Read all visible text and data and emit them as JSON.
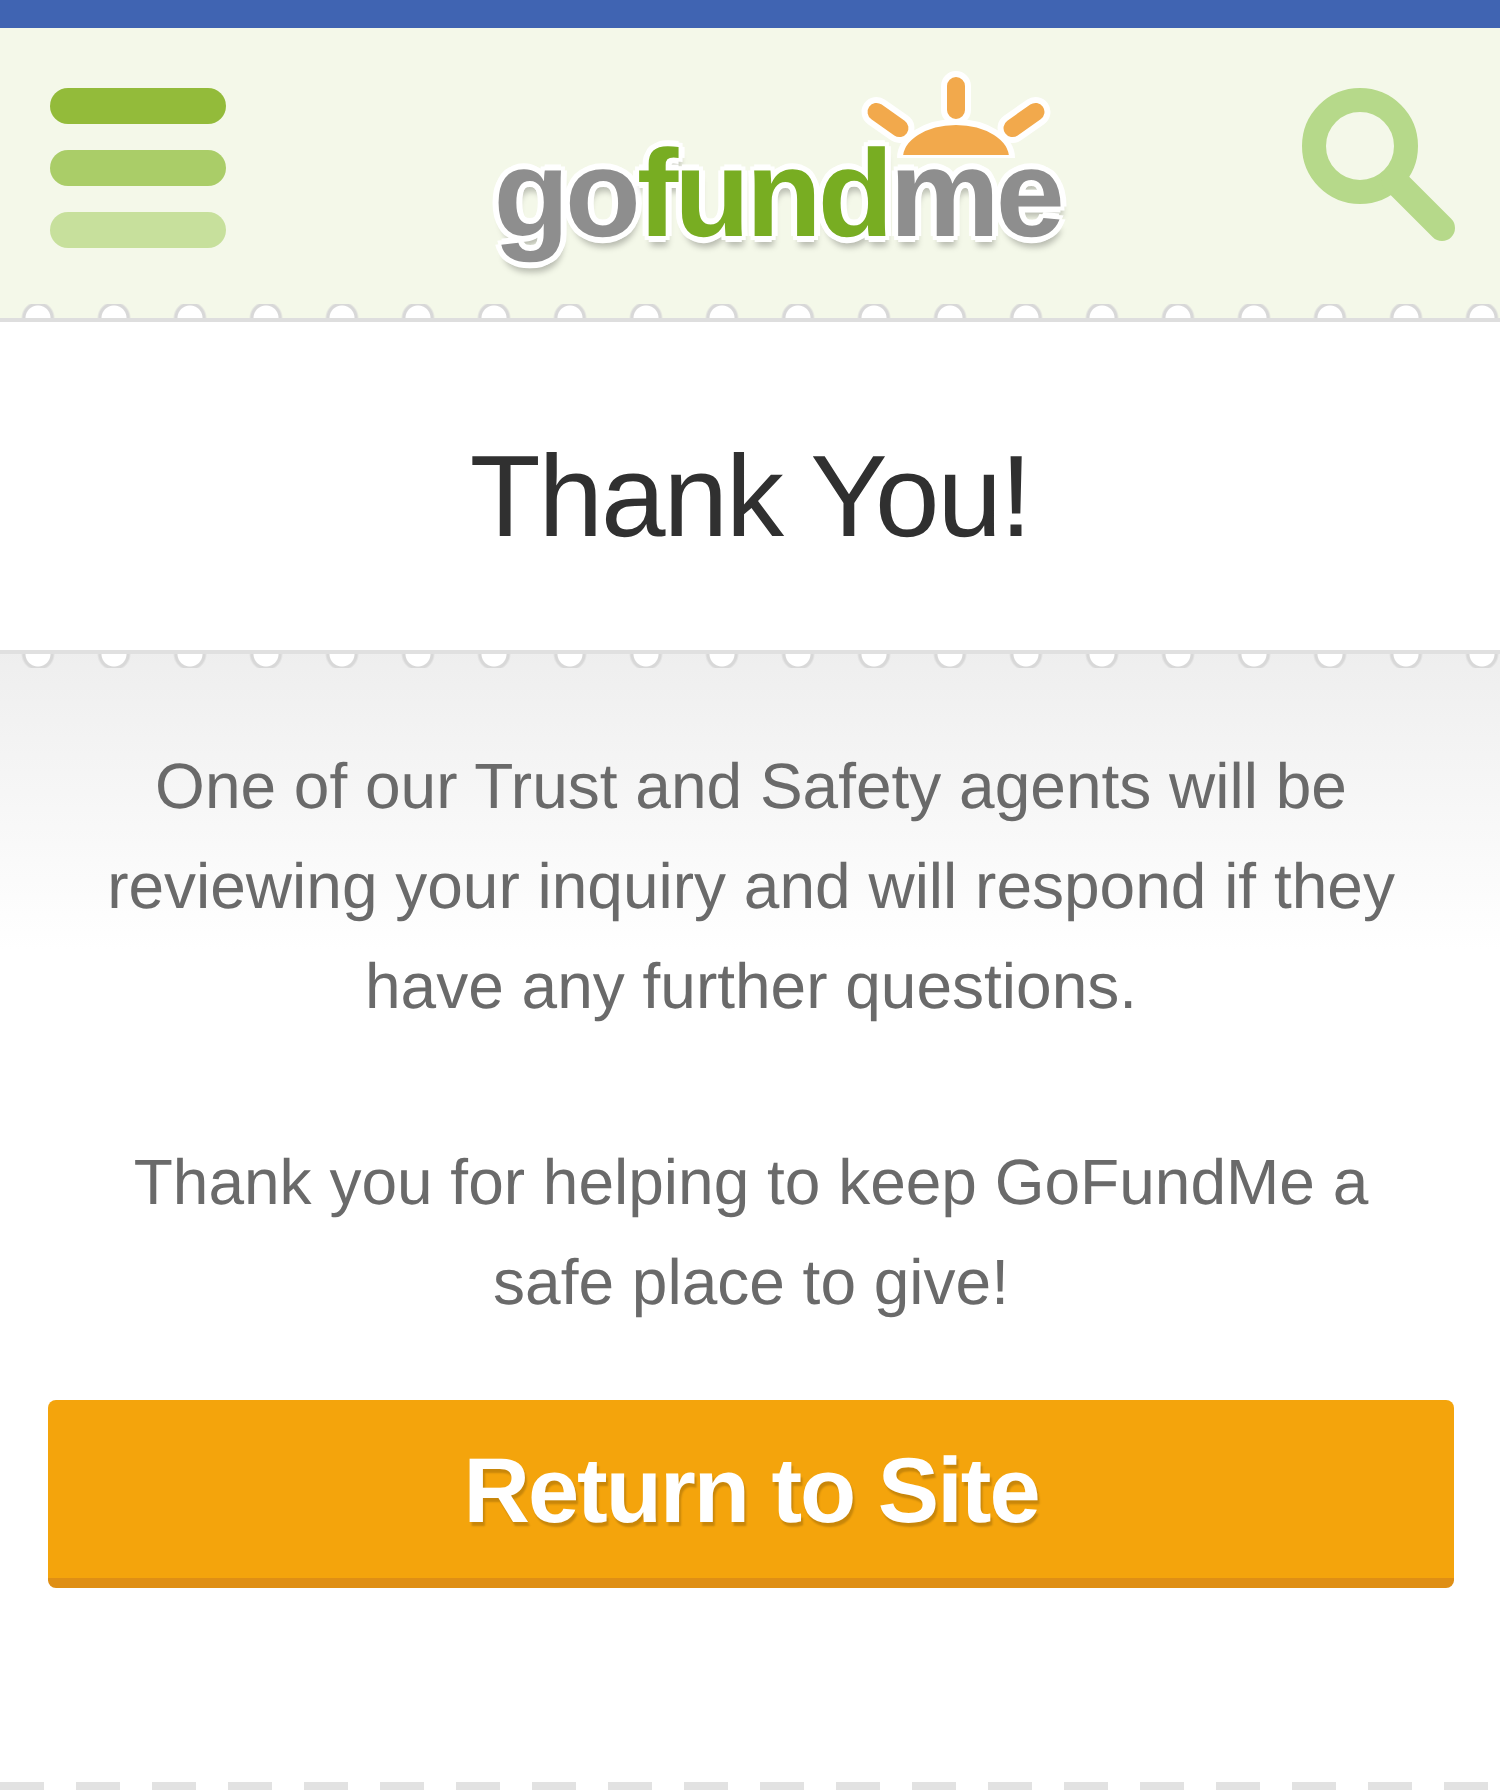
{
  "header": {
    "logo": {
      "parts": [
        {
          "text": "go",
          "color": "#8e8e8e"
        },
        {
          "text": "fund",
          "color": "#78ad22"
        },
        {
          "text": "me",
          "color": "#8e8e8e"
        }
      ]
    }
  },
  "title": "Thank You!",
  "message": {
    "paragraphs": [
      "One of our Trust and Safety agents will be reviewing your inquiry and will respond if they have any further questions.",
      "Thank you for helping to keep GoFundMe a safe place to give!"
    ]
  },
  "button": {
    "label": "Return to Site"
  }
}
